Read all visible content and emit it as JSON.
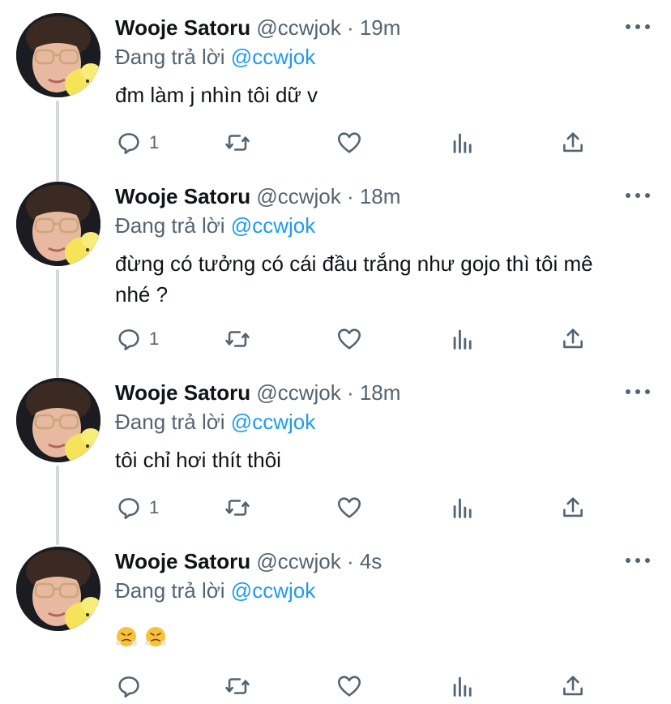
{
  "tweets": [
    {
      "name": "Wooje Satoru",
      "handle": "@ccwjok",
      "time": "· 19m",
      "reply_prefix": "Đang trả lời",
      "reply_to": "@ccwjok",
      "text": "đm làm j nhìn tôi dữ v",
      "reply_count": "1"
    },
    {
      "name": "Wooje Satoru",
      "handle": "@ccwjok",
      "time": "· 18m",
      "reply_prefix": "Đang trả lời",
      "reply_to": "@ccwjok",
      "text": "đừng có tưởng có cái đầu trắng như gojo thì tôi mê nhé ?",
      "reply_count": "1"
    },
    {
      "name": "Wooje Satoru",
      "handle": "@ccwjok",
      "time": "· 18m",
      "reply_prefix": "Đang trả lời",
      "reply_to": "@ccwjok",
      "text": "tôi chỉ hơi thít thôi",
      "reply_count": "1"
    },
    {
      "name": "Wooje Satoru",
      "handle": "@ccwjok",
      "time": "· 4s",
      "reply_prefix": "Đang trả lời",
      "reply_to": "@ccwjok",
      "text": "",
      "emojis": [
        "face-with-steam-emoji",
        "face-with-steam-emoji"
      ],
      "reply_count": ""
    }
  ],
  "colors": {
    "accent": "#1d9bf0",
    "secondary_text": "#536471",
    "thread_line": "#cfd9de"
  },
  "icons": {
    "reply": "reply-bubble-icon",
    "retweet": "retweet-icon",
    "like": "heart-icon",
    "stats": "stats-bars-icon",
    "share": "share-upload-icon",
    "more": "more-dots-icon"
  }
}
